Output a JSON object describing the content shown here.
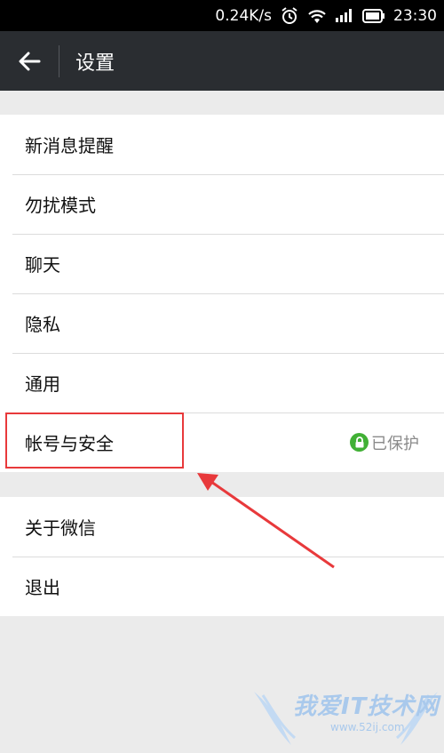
{
  "status_bar": {
    "net_speed": "0.24K/s",
    "time": "23:30"
  },
  "app_bar": {
    "title": "设置"
  },
  "group1": {
    "items": [
      {
        "label": "新消息提醒"
      },
      {
        "label": "勿扰模式"
      },
      {
        "label": "聊天"
      },
      {
        "label": "隐私"
      },
      {
        "label": "通用"
      },
      {
        "label": "帐号与安全",
        "status": "已保护"
      }
    ]
  },
  "group2": {
    "items": [
      {
        "label": "关于微信"
      },
      {
        "label": "退出"
      }
    ]
  },
  "annotation": {
    "highlight_color": "#e8393b"
  },
  "watermark": {
    "text": "我爱IT技术网",
    "url": "www.52ij.com"
  },
  "colors": {
    "app_bar": "#2a2d31",
    "background": "#ebebeb",
    "lock_green": "#41b035"
  }
}
